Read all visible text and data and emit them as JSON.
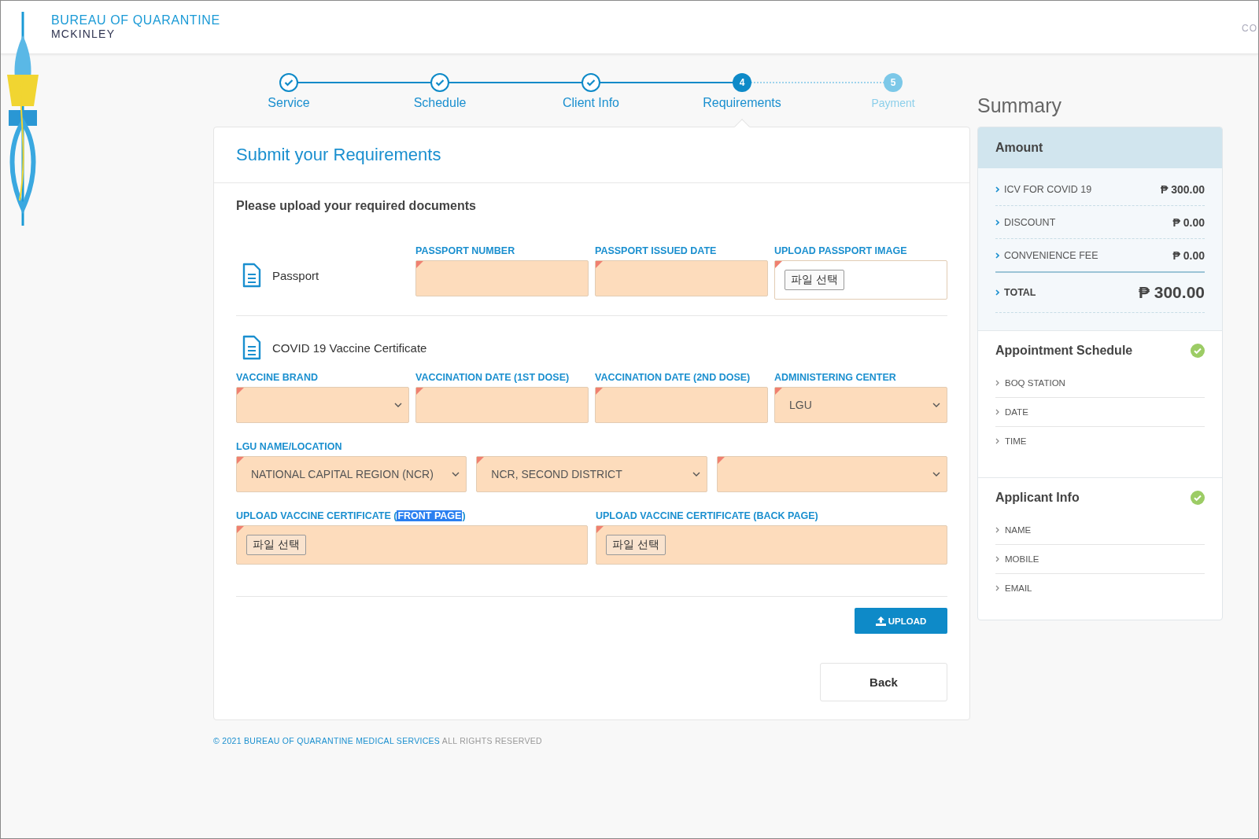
{
  "header": {
    "title": "BUREAU OF QUARANTINE",
    "subtitle": "MCKINLEY",
    "link": "CO"
  },
  "steps": [
    {
      "label": "Service",
      "done": true,
      "selected": false
    },
    {
      "label": "Schedule",
      "done": true,
      "selected": false
    },
    {
      "label": "Client Info",
      "done": true,
      "selected": false
    },
    {
      "label": "Requirements",
      "done": false,
      "selected": true,
      "number": "4"
    },
    {
      "label": "Payment",
      "done": false,
      "selected": false,
      "number": "5"
    }
  ],
  "form": {
    "title": "Submit your Requirements",
    "instruction": "Please upload your required documents",
    "sections": [
      {
        "kind": "inline",
        "title": "Passport",
        "rows": [
          {
            "fields": [
              {
                "kind": "text",
                "label": "PASSPORT NUMBER",
                "highlighted": true
              },
              {
                "kind": "text",
                "label": "PASSPORT ISSUED DATE",
                "highlighted": true
              },
              {
                "kind": "file",
                "label": "UPLOAD PASSPORT IMAGE",
                "highlighted": false,
                "button": "파일 선택"
              }
            ]
          }
        ]
      },
      {
        "kind": "stacked",
        "title": "COVID 19 Vaccine Certificate",
        "rows": [
          {
            "fields": [
              {
                "kind": "select",
                "label": "VACCINE BRAND",
                "highlighted": true
              },
              {
                "kind": "text",
                "label": "VACCINATION DATE (1ST DOSE)",
                "highlighted": true
              },
              {
                "kind": "text",
                "label": "VACCINATION DATE (2ND DOSE)",
                "highlighted": true
              },
              {
                "kind": "select",
                "label": "ADMINISTERING CENTER",
                "highlighted": true,
                "value": "LGU"
              }
            ]
          },
          {
            "label": "LGU NAME/LOCATION",
            "fields": [
              {
                "kind": "select",
                "highlighted": true,
                "value": "NATIONAL CAPITAL REGION (NCR)"
              },
              {
                "kind": "select",
                "highlighted": true,
                "value": "NCR, SECOND DISTRICT"
              },
              {
                "kind": "select",
                "highlighted": true
              }
            ]
          },
          {
            "fields": [
              {
                "kind": "file",
                "label_parts": [
                  {
                    "text": "UPLOAD VACCINE CERTIFICATE (",
                    "selected": false
                  },
                  {
                    "text": "FRONT PAGE",
                    "selected": true
                  },
                  {
                    "text": ")",
                    "selected": false
                  }
                ],
                "highlighted": true,
                "button": "파일 선택"
              },
              {
                "kind": "file",
                "label_parts": [
                  {
                    "text": "UPLOAD VACCINE CERTIFICATE (BACK PAGE)",
                    "selected": false
                  }
                ],
                "highlighted": true,
                "button": "파일 선택"
              }
            ]
          }
        ]
      }
    ],
    "upload_button": "UPLOAD",
    "back_button": "Back"
  },
  "summary": {
    "title": "Summary",
    "amount": {
      "title": "Amount",
      "items": [
        {
          "label": "ICV FOR COVID 19",
          "value": "₱ 300.00"
        },
        {
          "label": "DISCOUNT",
          "value": "₱ 0.00"
        },
        {
          "label": "CONVENIENCE FEE",
          "value": "₱ 0.00"
        }
      ],
      "total": {
        "label": "TOTAL",
        "value": "₱ 300.00"
      }
    },
    "sections": [
      {
        "title": "Appointment Schedule",
        "complete": true,
        "items": [
          "BOQ STATION",
          "DATE",
          "TIME"
        ]
      },
      {
        "title": "Applicant Info",
        "complete": true,
        "items": [
          "NAME",
          "MOBILE",
          "EMAIL"
        ]
      }
    ]
  },
  "footer": {
    "year": "© 2021",
    "link": "BUREAU OF QUARANTINE MEDICAL SERVICES",
    "rights": "ALL RIGHTS RESERVED"
  }
}
